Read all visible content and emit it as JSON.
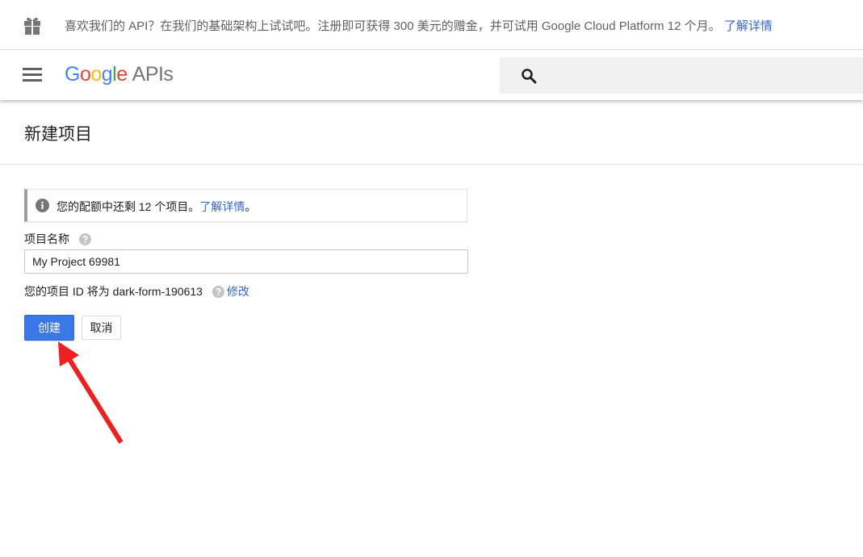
{
  "promo": {
    "message": "喜欢我们的 API？在我们的基础架构上试试吧。注册即可获得 300 美元的赠金，并可试用 Google Cloud Platform 12 个月。",
    "link_label": "了解详情"
  },
  "header": {
    "logo_letters": [
      "G",
      "o",
      "o",
      "g",
      "l",
      "e"
    ],
    "logo_suffix": "APIs",
    "search_placeholder": ""
  },
  "page": {
    "title": "新建项目"
  },
  "quota": {
    "message": "您的配额中还剩 12 个项目。",
    "link_label": "了解详情",
    "trailing": "。"
  },
  "form": {
    "name_label": "项目名称",
    "name_value": "My Project 69981",
    "project_id_text": "您的项目 ID 将为 dark-form-190613",
    "edit_label": "修改",
    "create_label": "创建",
    "cancel_label": "取消"
  },
  "colors": {
    "accent": "#3b78e7",
    "link": "#3367d6",
    "annotation_arrow": "#f01e1e"
  }
}
